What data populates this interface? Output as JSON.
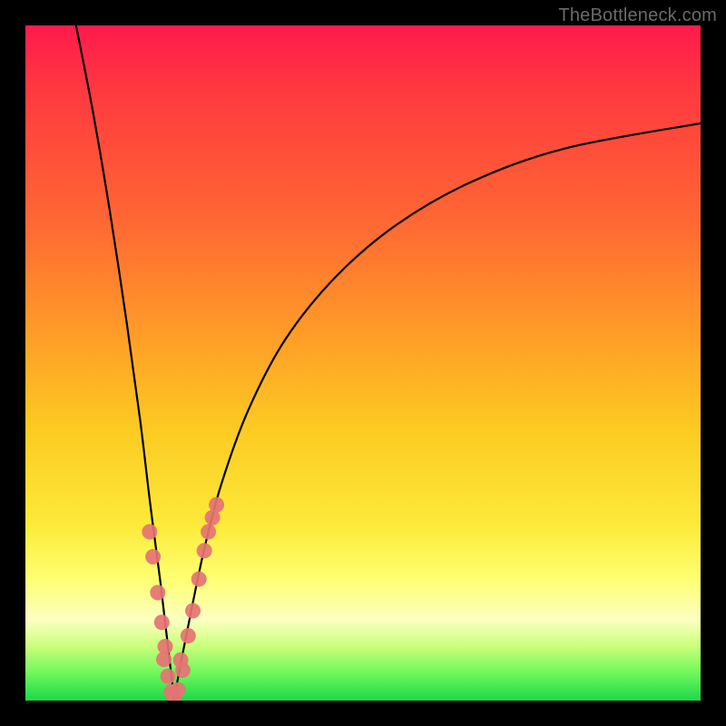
{
  "watermark": "TheBottleneck.com",
  "gradient_colors": {
    "top": "#ff1a4c",
    "mid_upper": "#ff9a28",
    "mid": "#fdea3a",
    "pale": "#fcffc0",
    "green": "#1cd84a"
  },
  "chart_data": {
    "type": "line",
    "title": "",
    "xlabel": "",
    "ylabel": "",
    "xlim": [
      0,
      100
    ],
    "ylim": [
      0,
      100
    ],
    "grid": false,
    "legend": false,
    "note": "Axes are unlabeled in the source image. x/y are image-relative percentages (0–100 each). Two black curves forming a deep V-notch centered near x≈22, plus clustered pink dot markers along the curves near the bottom.",
    "series": [
      {
        "name": "left-branch",
        "type": "line",
        "color": "#000000",
        "x": [
          7.5,
          10,
          12.5,
          15,
          17,
          18.5,
          20,
          21,
          21.7,
          22
        ],
        "y": [
          100,
          87.2,
          72.5,
          56,
          41.5,
          29,
          17.5,
          9,
          3,
          0
        ]
      },
      {
        "name": "right-branch",
        "type": "line",
        "color": "#000000",
        "x": [
          22,
          23,
          24.5,
          26.5,
          29,
          33,
          38.5,
          46,
          55,
          66,
          80,
          100
        ],
        "y": [
          0,
          5.5,
          13,
          22.5,
          32,
          43,
          53.5,
          62.8,
          70.5,
          76.8,
          81.8,
          85.5
        ]
      },
      {
        "name": "dots-left",
        "type": "scatter",
        "color": "#e57373",
        "x": [
          18.4,
          18.9,
          19.6,
          20.2,
          20.7,
          20.5,
          21.1,
          21.6,
          22.0
        ],
        "y": [
          25.0,
          21.3,
          16.0,
          11.6,
          8.0,
          6.1,
          3.6,
          1.3,
          0.6
        ]
      },
      {
        "name": "dots-right",
        "type": "scatter",
        "color": "#e57373",
        "x": [
          22.6,
          23.3,
          23.0,
          24.1,
          24.8,
          25.7,
          26.5,
          27.1,
          27.7,
          28.3
        ],
        "y": [
          1.6,
          4.5,
          6.0,
          9.6,
          13.3,
          18.0,
          22.2,
          25.0,
          27.1,
          29.0
        ]
      }
    ]
  }
}
